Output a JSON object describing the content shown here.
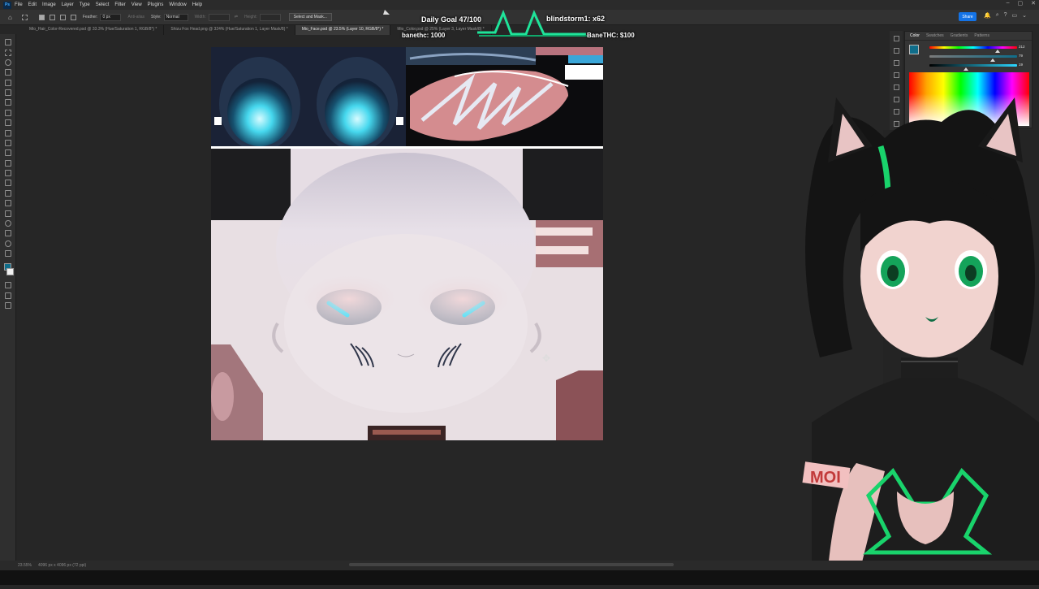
{
  "menubar": {
    "items": [
      "File",
      "Edit",
      "Image",
      "Layer",
      "Type",
      "Select",
      "Filter",
      "View",
      "Plugins",
      "Window",
      "Help"
    ]
  },
  "options": {
    "feather_label": "Feather:",
    "feather_value": "0 px",
    "antialias_label": "Anti-alias",
    "style_label": "Style:",
    "style_value": "Normal",
    "width_label": "Width:",
    "height_label": "Height:",
    "select_mask_button": "Select and Mask..."
  },
  "share_button": "Share",
  "tabs": [
    {
      "label": "Mio_Hair_Color-Recovered.psd @ 33.3% (Hue/Saturation 1, RGB/8*) *"
    },
    {
      "label": "Shizu Fox Head.png @ 324% (Hue/Saturation 1, Layer Mask/8) *"
    },
    {
      "label": "Mio_Face.psd @ 23.5% (Layer 10, RGB/8*) *"
    },
    {
      "label": "Mio_Color.psd @ 25% (Layer 3, Layer Mask/8) *"
    }
  ],
  "stream_overlay": {
    "daily_goal": "Daily Goal 47/100",
    "top_user": "blindstorm1: x62",
    "top_donor": "banethc: 1000",
    "top_tip": "BaneTHC: $100"
  },
  "color_panel": {
    "tabs": [
      "Color",
      "Swatches",
      "Gradients",
      "Patterns"
    ],
    "values": [
      "212",
      "79",
      "19"
    ],
    "fill_fractions": [
      0.78,
      0.72,
      0.42
    ],
    "fg_color": "#0f6d8a",
    "bg_color": "#ffffff"
  },
  "statusbar": {
    "zoom": "23.55%",
    "doc_size": "4096 px x 4096 px (72 ppi)"
  },
  "avatar": {
    "armband_text": "MOI",
    "accent_color": "#19d36b",
    "hair_color": "#141414"
  }
}
